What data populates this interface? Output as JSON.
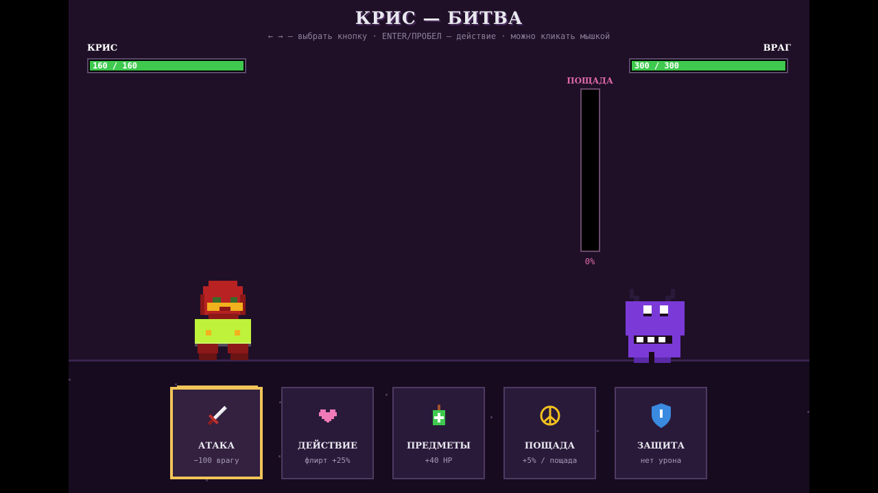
{
  "title": "КРИС — БИТВА",
  "hint": "← → — выбрать кнопку · ENTER/ПРОБЕЛ — действие · можно кликать мышкой",
  "player": {
    "name": "КРИС",
    "hp_text": "160 / 160",
    "hp_fraction": 1.0,
    "hp_color": "#3fc94f"
  },
  "enemy": {
    "name": "ВРАГ",
    "hp_text": "300 / 300",
    "hp_fraction": 1.0
  },
  "mercy": {
    "label": "ПОЩАДА",
    "percent_text": "0%",
    "fraction": 0.0
  },
  "colors": {
    "accent": "#f2c55a",
    "mercy": "#e06aa8",
    "background": "#1f1028"
  },
  "buttons": [
    {
      "id": "attack",
      "title": "АТАКА",
      "sub": "−100 врагу",
      "icon": "sword-icon",
      "active": true
    },
    {
      "id": "act",
      "title": "ДЕЙСТВИЕ",
      "sub": "флирт +25%",
      "icon": "heart-icon",
      "active": false
    },
    {
      "id": "items",
      "title": "ПРЕДМЕТЫ",
      "sub": "+40 HP",
      "icon": "potion-icon",
      "active": false
    },
    {
      "id": "spare",
      "title": "ПОЩАДА",
      "sub": "+5% / пощада",
      "icon": "peace-icon",
      "active": false
    },
    {
      "id": "defend",
      "title": "ЗАЩИТА",
      "sub": "нет урона",
      "icon": "shield-icon",
      "active": false
    }
  ]
}
